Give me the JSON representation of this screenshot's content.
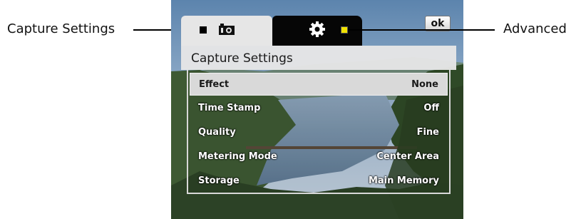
{
  "callouts": {
    "left": "Capture Settings",
    "right": "Advanced"
  },
  "tabs": [
    {
      "name": "Capture Settings",
      "icon": "camera-icon",
      "selected": true
    },
    {
      "name": "Advanced",
      "icon": "gear-icon",
      "selected": false
    }
  ],
  "ok_label": "ok",
  "panel": {
    "title": "Capture Settings",
    "settings": [
      {
        "label": "Effect",
        "value": "None",
        "selected": true
      },
      {
        "label": "Time Stamp",
        "value": "Off",
        "selected": false
      },
      {
        "label": "Quality",
        "value": "Fine",
        "selected": false
      },
      {
        "label": "Metering Mode",
        "value": "Center Area",
        "selected": false
      },
      {
        "label": "Storage",
        "value": "Main Memory",
        "selected": false
      }
    ]
  },
  "colors": {
    "tab_selected": "#e6e6e6",
    "tab_unselected": "#060606",
    "callout_marker": "#f1e200",
    "row_selected": "#d9d9d9"
  }
}
